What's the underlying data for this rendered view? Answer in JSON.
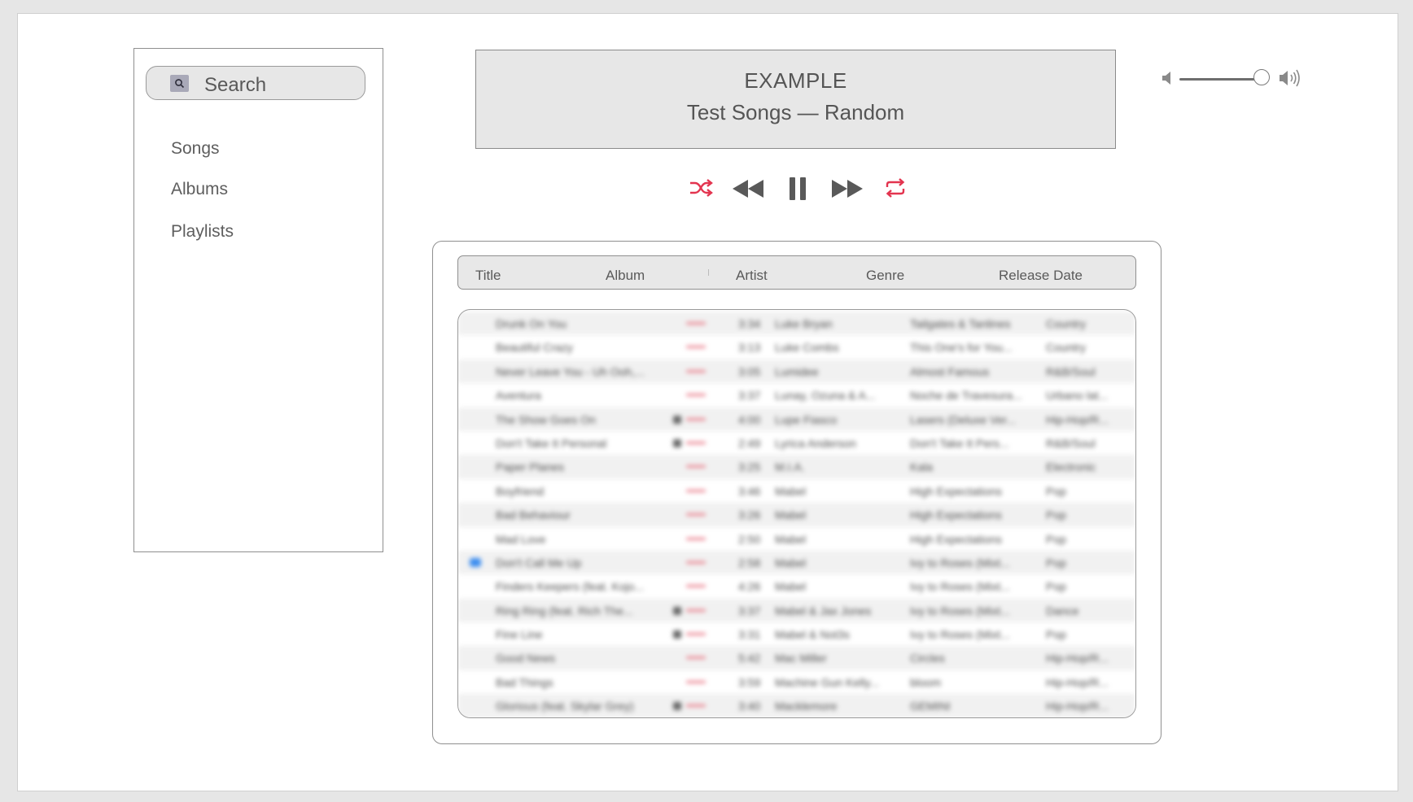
{
  "sidebar": {
    "search_placeholder": "Search",
    "items": [
      {
        "label": "Songs"
      },
      {
        "label": "Albums"
      },
      {
        "label": "Playlists"
      }
    ]
  },
  "now_playing": {
    "title": "EXAMPLE",
    "subtitle": "Test Songs — Random"
  },
  "controls": {
    "accent_color": "#e3344f",
    "icons": [
      "shuffle-icon",
      "rewind-icon",
      "pause-icon",
      "fast-forward-icon",
      "repeat-icon"
    ]
  },
  "volume": {
    "level": 0.95
  },
  "library": {
    "columns": [
      "Title",
      "Album",
      "Artist",
      "Genre",
      "Release Date"
    ],
    "tracks": [
      {
        "title": "Drunk On You",
        "time": "3:34",
        "artist": "Luke Bryan",
        "album": "Tailgates & Tanlines",
        "genre": "Country",
        "badge": false,
        "playing": false
      },
      {
        "title": "Beautiful Crazy",
        "time": "3:13",
        "artist": "Luke Combs",
        "album": "This One's for You...",
        "genre": "Country",
        "badge": false,
        "playing": false
      },
      {
        "title": "Never Leave You - Uh Ooh,...",
        "time": "3:05",
        "artist": "Lumidee",
        "album": "Almost Famous",
        "genre": "R&B/Soul",
        "badge": false,
        "playing": false
      },
      {
        "title": "Aventura",
        "time": "3:37",
        "artist": "Lunay, Ozuna & A...",
        "album": "Noche de Travesura...",
        "genre": "Urbano lat...",
        "badge": false,
        "playing": false
      },
      {
        "title": "The Show Goes On",
        "time": "4:00",
        "artist": "Lupe Fiasco",
        "album": "Lasers (Deluxe Ver...",
        "genre": "Hip-Hop/R...",
        "badge": true,
        "playing": false
      },
      {
        "title": "Don't Take It Personal",
        "time": "2:49",
        "artist": "Lyrica Anderson",
        "album": "Don't Take It Pers...",
        "genre": "R&B/Soul",
        "badge": true,
        "playing": false
      },
      {
        "title": "Paper Planes",
        "time": "3:25",
        "artist": "M.I.A.",
        "album": "Kala",
        "genre": "Electronic",
        "badge": false,
        "playing": false
      },
      {
        "title": "Boyfriend",
        "time": "3:46",
        "artist": "Mabel",
        "album": "High Expectations",
        "genre": "Pop",
        "badge": false,
        "playing": false
      },
      {
        "title": "Bad Behaviour",
        "time": "3:26",
        "artist": "Mabel",
        "album": "High Expectations",
        "genre": "Pop",
        "badge": false,
        "playing": false
      },
      {
        "title": "Mad Love",
        "time": "2:50",
        "artist": "Mabel",
        "album": "High Expectations",
        "genre": "Pop",
        "badge": false,
        "playing": false
      },
      {
        "title": "Don't Call Me Up",
        "time": "2:58",
        "artist": "Mabel",
        "album": "Ivy to Roses (Mixt...",
        "genre": "Pop",
        "badge": false,
        "playing": true
      },
      {
        "title": "Finders Keepers (feat. Kojo...",
        "time": "4:26",
        "artist": "Mabel",
        "album": "Ivy to Roses (Mixt...",
        "genre": "Pop",
        "badge": false,
        "playing": false
      },
      {
        "title": "Ring Ring (feat. Rich The...",
        "time": "3:37",
        "artist": "Mabel & Jax Jones",
        "album": "Ivy to Roses (Mixt...",
        "genre": "Dance",
        "badge": true,
        "playing": false
      },
      {
        "title": "Fine Line",
        "time": "3:31",
        "artist": "Mabel & Not3s",
        "album": "Ivy to Roses (Mixt...",
        "genre": "Pop",
        "badge": true,
        "playing": false
      },
      {
        "title": "Good News",
        "time": "5:42",
        "artist": "Mac Miller",
        "album": "Circles",
        "genre": "Hip-Hop/R...",
        "badge": false,
        "playing": false
      },
      {
        "title": "Bad Things",
        "time": "3:59",
        "artist": "Machine Gun Kelly...",
        "album": "bloom",
        "genre": "Hip-Hop/R...",
        "badge": false,
        "playing": false
      },
      {
        "title": "Glorious (feat. Skylar Grey)",
        "time": "3:40",
        "artist": "Macklemore",
        "album": "GEMINI",
        "genre": "Hip-Hop/R...",
        "badge": true,
        "playing": false
      }
    ]
  }
}
